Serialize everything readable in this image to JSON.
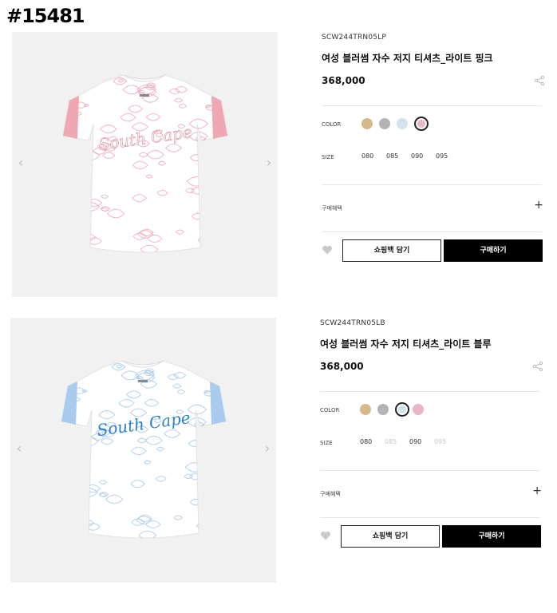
{
  "page_title": "#15481",
  "products": [
    {
      "code": "SCW244TRN05LP",
      "name": "여성 블러썸 자수 저지 티셔츠_라이트 핑크",
      "price": "368,000",
      "color_label": "COLOR",
      "size_label": "SIZE",
      "benefit_label": "구매혜택",
      "plus": "+",
      "bag_label": "쇼핑백 담기",
      "buy_label": "구매하기",
      "image_logo_text": "South Cape",
      "colors": [
        {
          "name": "beige",
          "hex": "#d6b98a",
          "selected": false
        },
        {
          "name": "grey",
          "hex": "#b3b3b3",
          "selected": false
        },
        {
          "name": "light-blue",
          "hex": "#d2e3ea",
          "selected": false
        },
        {
          "name": "light-pink",
          "hex": "#e9b6c4",
          "selected": true
        }
      ],
      "sizes": [
        {
          "label": "080",
          "available": true
        },
        {
          "label": "085",
          "available": true
        },
        {
          "label": "090",
          "available": true
        },
        {
          "label": "095",
          "available": true
        }
      ],
      "shirt_accent": "#f0a7b4",
      "shirt_pattern": "#eaa2b2"
    },
    {
      "code": "SCW244TRN05LB",
      "name": "여성 블러썸 자수 저지 티셔츠_라이트 블루",
      "price": "368,000",
      "color_label": "COLOR",
      "size_label": "SIZE",
      "benefit_label": "구매혜택",
      "plus": "+",
      "bag_label": "쇼핑백 담기",
      "buy_label": "구매하기",
      "image_logo_text": "South Cape",
      "colors": [
        {
          "name": "beige",
          "hex": "#d6b98a",
          "selected": false
        },
        {
          "name": "grey",
          "hex": "#b3b3b3",
          "selected": false
        },
        {
          "name": "light-blue",
          "hex": "#d2e3ea",
          "selected": true
        },
        {
          "name": "light-pink",
          "hex": "#e9b6c4",
          "selected": false
        }
      ],
      "sizes": [
        {
          "label": "080",
          "available": true
        },
        {
          "label": "085",
          "available": false
        },
        {
          "label": "090",
          "available": true
        },
        {
          "label": "095",
          "available": false
        }
      ],
      "shirt_accent": "#a9cbee",
      "shirt_pattern": "#9fc3e6"
    }
  ]
}
